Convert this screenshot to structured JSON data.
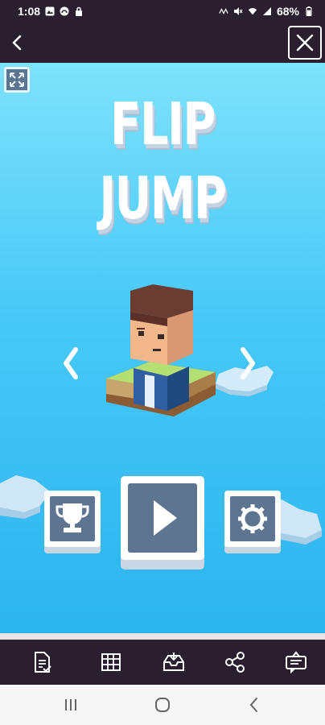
{
  "status_bar": {
    "time": "1:08",
    "battery": "68%",
    "left_icons": [
      "gallery-icon",
      "notification-icon",
      "lock-icon"
    ],
    "right_icons": [
      "hd-voice-icon",
      "mute-icon",
      "wifi-icon",
      "signal-icon",
      "battery-icon"
    ]
  },
  "header": {
    "back_icon": "chevron-left-icon",
    "close_icon": "close-icon"
  },
  "game": {
    "title_line1": "FLIP",
    "title_line2": "JUMP",
    "expand_icon": "expand-icon",
    "prev_icon": "chevron-left-icon",
    "next_icon": "chevron-right-icon",
    "buttons": [
      {
        "name": "leaderboard",
        "icon": "trophy-icon"
      },
      {
        "name": "play",
        "icon": "play-icon"
      },
      {
        "name": "settings",
        "icon": "gear-icon"
      }
    ],
    "colors": {
      "sky_top": "#7ee2fb",
      "sky_bottom": "#2cb4ef",
      "button_face": "#5d7590",
      "button_border": "#ffffff",
      "platform_top": "#a8d66c",
      "platform_side": "#9b6a3f"
    }
  },
  "toolbar": {
    "items": [
      "document-icon",
      "grid-icon",
      "inbox-icon",
      "share-icon",
      "chat-icon"
    ]
  },
  "nav": {
    "items": [
      "recent-apps-icon",
      "home-icon",
      "back-icon"
    ]
  }
}
